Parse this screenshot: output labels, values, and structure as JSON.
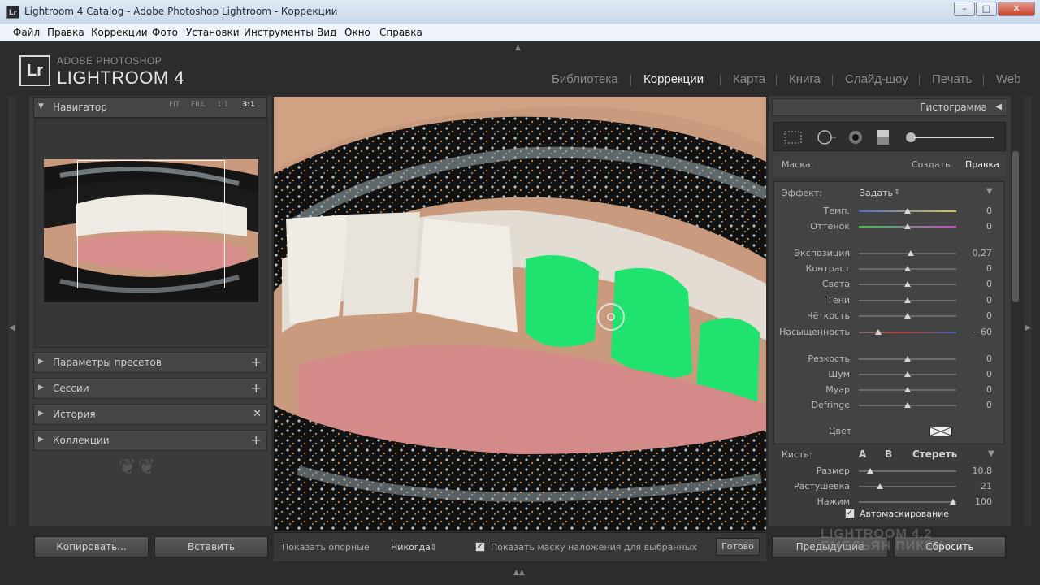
{
  "window": {
    "app_icon": "Lr",
    "title": "Lightroom 4 Catalog - Adobe Photoshop Lightroom - Коррекции",
    "minimize": "–",
    "maximize": "□",
    "close": "✕"
  },
  "menu": [
    "Файл",
    "Правка",
    "Коррекции",
    "Фото",
    "Установки",
    "Инструменты",
    "Вид",
    "Окно",
    "Справка"
  ],
  "logo": {
    "mark": "Lr",
    "line1": "ADOBE PHOTOSHOP",
    "line2": "LIGHTROOM 4"
  },
  "modules": [
    "Библиотека",
    "Коррекции",
    "Карта",
    "Книга",
    "Слайд-шоу",
    "Печать",
    "Web"
  ],
  "active_module": "Коррекции",
  "navigator": {
    "title": "Навигатор",
    "options": [
      "FIT",
      "FILL",
      "1:1",
      "3:1"
    ],
    "active_option": "3:1"
  },
  "left_panels": [
    {
      "label": "Параметры пресетов",
      "action": "+"
    },
    {
      "label": "Сессии",
      "action": "+"
    },
    {
      "label": "История",
      "action": "✕"
    },
    {
      "label": "Коллекции",
      "action": "+"
    }
  ],
  "left_buttons": {
    "copy": "Копировать...",
    "paste": "Вставить"
  },
  "toolbar": {
    "show_pins_label": "Показать опорные",
    "show_pins_value": "Никогда",
    "overlay_check": "✓",
    "overlay_label": "Показать маску наложения для выбранных",
    "done": "Готово"
  },
  "right_header": "Гистограмма",
  "mask": {
    "label": "Маска:",
    "new": "Создать",
    "edit": "Правка"
  },
  "effect": {
    "label": "Эффект:",
    "value": "Задать",
    "color_label": "Цвет",
    "sliders": [
      {
        "label": "Темп.",
        "value": "0",
        "pos": 0.5
      },
      {
        "label": "Оттенок",
        "value": "0",
        "pos": 0.5
      },
      {
        "label": "Экспозиция",
        "value": "0,27",
        "pos": 0.535
      },
      {
        "label": "Контраст",
        "value": "0",
        "pos": 0.5
      },
      {
        "label": "Света",
        "value": "0",
        "pos": 0.5
      },
      {
        "label": "Тени",
        "value": "0",
        "pos": 0.5
      },
      {
        "label": "Чёткость",
        "value": "0",
        "pos": 0.5
      },
      {
        "label": "Насыщенность",
        "value": "−60",
        "pos": 0.2
      },
      {
        "label": "Резкость",
        "value": "0",
        "pos": 0.5
      },
      {
        "label": "Шум",
        "value": "0",
        "pos": 0.5
      },
      {
        "label": "Муар",
        "value": "0",
        "pos": 0.5
      },
      {
        "label": "Defringe",
        "value": "0",
        "pos": 0.5
      }
    ]
  },
  "brush": {
    "label": "Кисть:",
    "a": "A",
    "b": "B",
    "erase": "Стереть",
    "sliders": [
      {
        "label": "Размер",
        "value": "10,8",
        "pos": 0.12
      },
      {
        "label": "Растушёвка",
        "value": "21",
        "pos": 0.22
      },
      {
        "label": "Нажим",
        "value": "100",
        "pos": 0.97
      }
    ],
    "automask_check": "✓",
    "automask": "Автомаскирование"
  },
  "right_buttons": {
    "previous": "Предыдущие",
    "reset": "Сбросить"
  },
  "watermark": [
    "LIGHTROOM 4.2",
    "ЕМЕЛЬЯН ПИКЕИ"
  ],
  "colors": {
    "mask_overlay": "#1fe36e",
    "panel": "#3b3b3b",
    "frame": "#2c2c2c"
  }
}
